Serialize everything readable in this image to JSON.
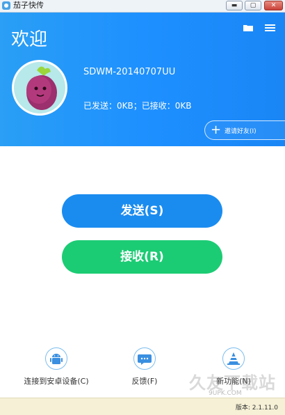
{
  "window": {
    "title": "茄子快传",
    "minimize_glyph": "▬",
    "maximize_glyph": "▢",
    "close_glyph": "✕"
  },
  "header": {
    "welcome": "欢迎",
    "username": "SDWM-20140707UU",
    "stats": "已发送：0KB；已接收：0KB",
    "invite_label": "邀请好友(I)",
    "invite_plus": "+"
  },
  "actions": {
    "send_label": "发送(S)",
    "receive_label": "接收(R)"
  },
  "bottom": {
    "android_label": "连接到安卓设备(C)",
    "feedback_label": "反馈(F)",
    "new_features_label": "新功能(N)"
  },
  "status": {
    "version": "版本: 2.1.11.0"
  },
  "watermark": {
    "text": "久友下载站",
    "sub": "9UPK.COM"
  },
  "colors": {
    "header_blue": "#1e90ff",
    "send_blue": "#1a8cf0",
    "receive_green": "#1ccc74"
  },
  "icons": [
    "folder-icon",
    "menu-icon",
    "android-icon",
    "feedback-icon",
    "new-features-icon"
  ]
}
